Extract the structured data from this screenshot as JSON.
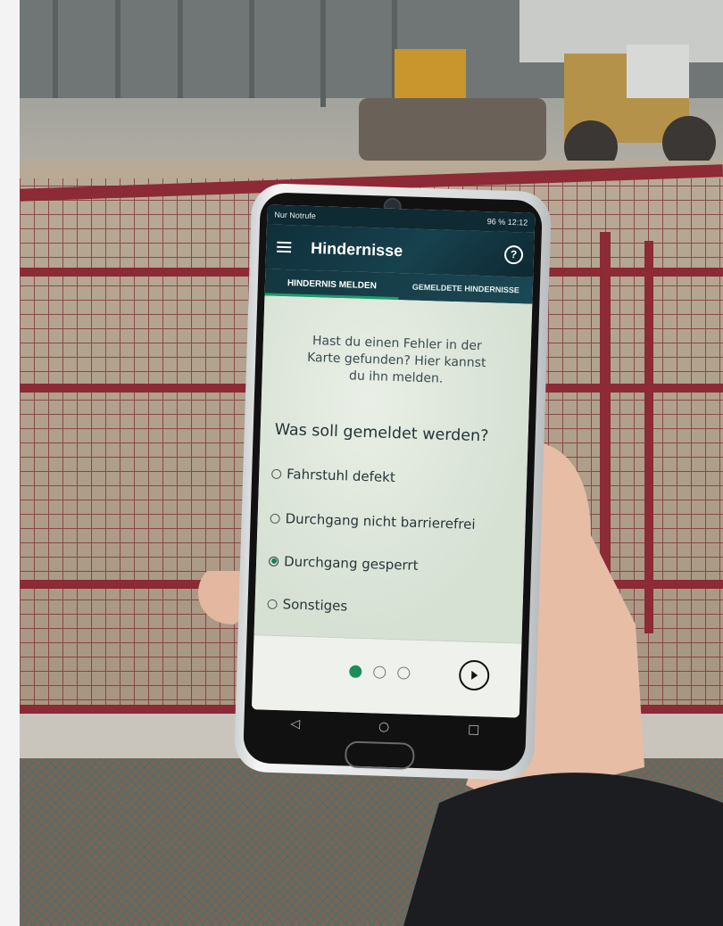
{
  "status_bar": {
    "left": "Nur Notrufe",
    "right": "96 %  12:12"
  },
  "app_bar": {
    "title": "Hindernisse",
    "help_glyph": "?",
    "menu_icon": "hamburger-icon"
  },
  "tabs": [
    {
      "label": "HINDERNIS MELDEN",
      "active": true
    },
    {
      "label": "GEMELDETE HINDERNISSE",
      "active": false
    }
  ],
  "intro_text": "Hast du einen Fehler in der Karte gefunden? Hier kannst du ihn melden.",
  "question": "Was soll gemeldet werden?",
  "options": [
    {
      "label": "Fahrstuhl defekt",
      "selected": false
    },
    {
      "label": "Durchgang nicht barrierefrei",
      "selected": false
    },
    {
      "label": "Durchgang gesperrt",
      "selected": true
    },
    {
      "label": "Sonstiges",
      "selected": false
    }
  ],
  "pager": {
    "pages": 3,
    "current": 1
  },
  "colors": {
    "app_bar": "#0f2f3a",
    "accent_green": "#1a8f5c",
    "fence_red": "#8c2a35",
    "screen_background": "#dfe6dc"
  }
}
